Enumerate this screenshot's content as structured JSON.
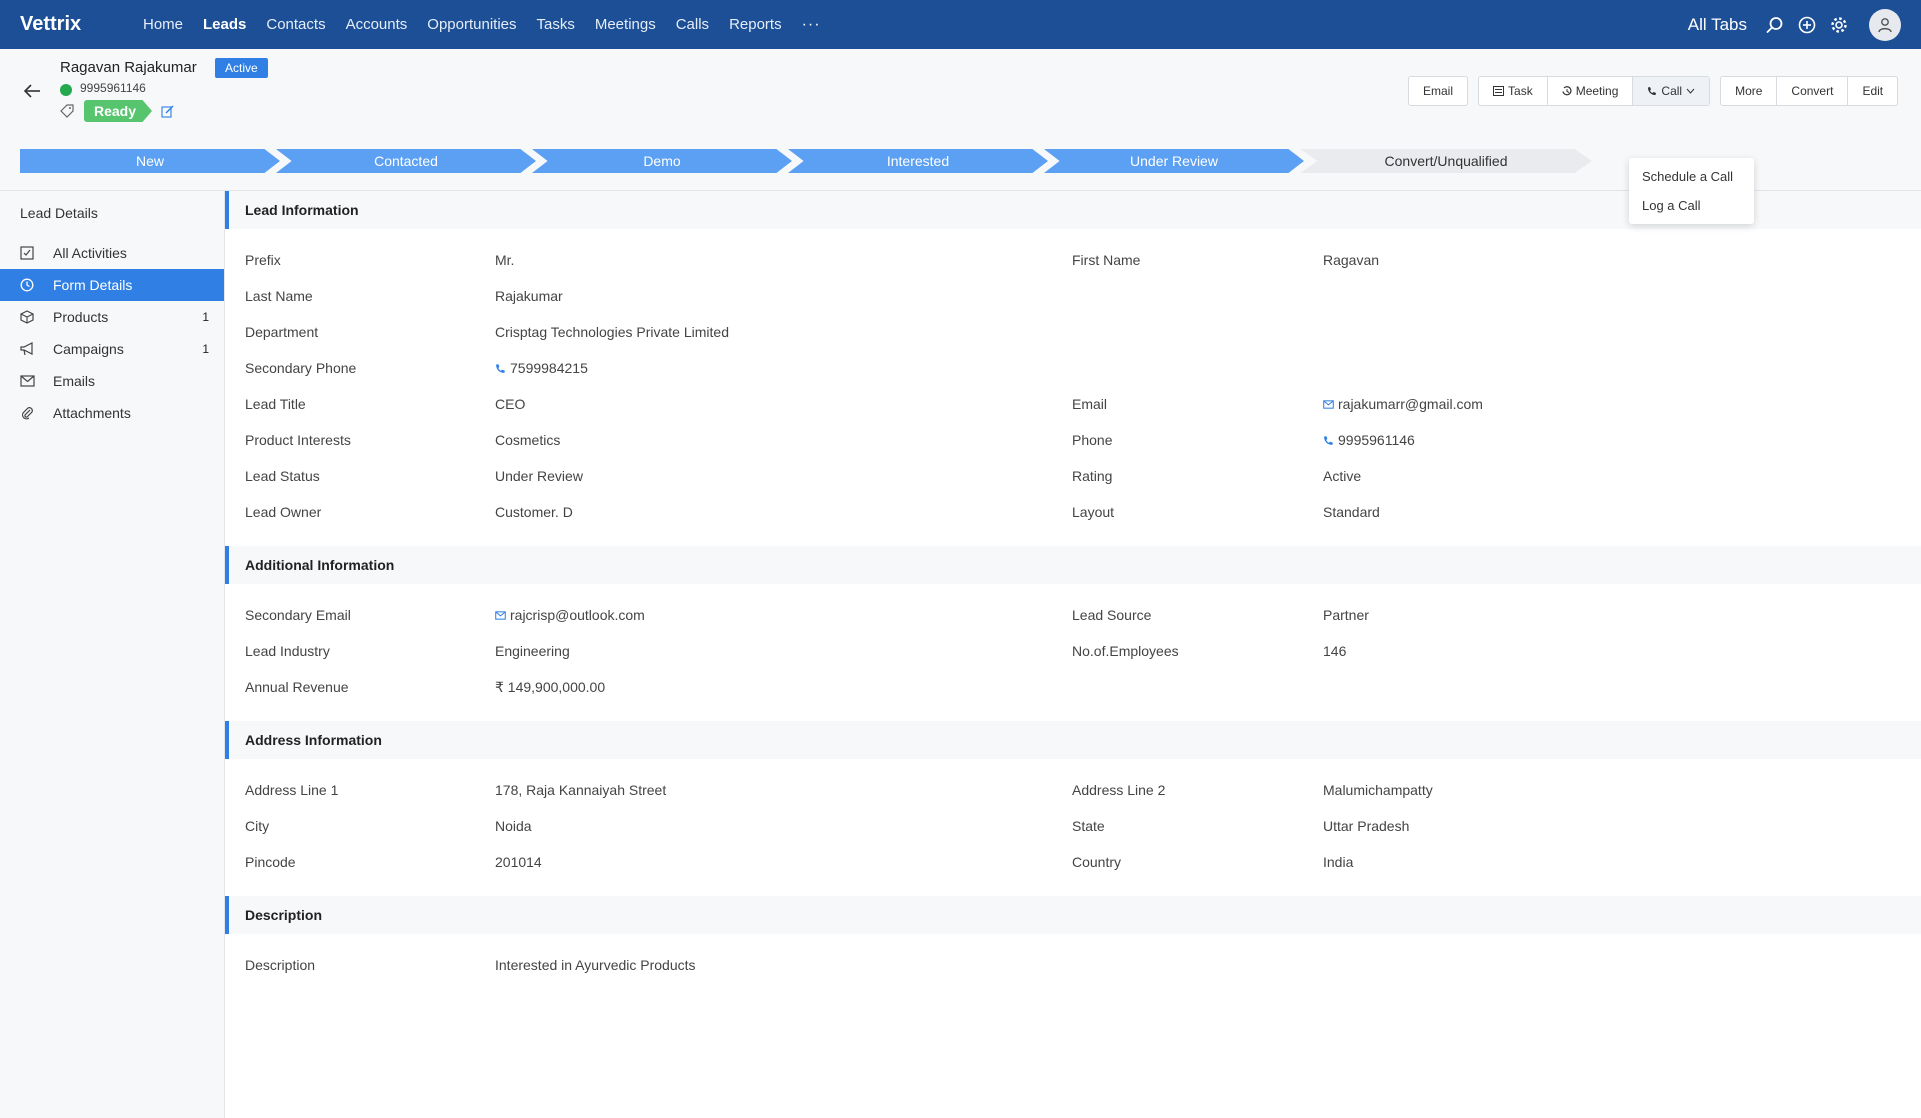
{
  "nav": {
    "brand": "Vettrix",
    "items": [
      "Home",
      "Leads",
      "Contacts",
      "Accounts",
      "Opportunities",
      "Tasks",
      "Meetings",
      "Calls",
      "Reports"
    ],
    "more": "···",
    "all_tabs": "All Tabs"
  },
  "header": {
    "name": "Ragavan Rajakumar",
    "status_badge": "Active",
    "phone": "9995961146",
    "stage_pill": "Ready"
  },
  "actions": {
    "email": "Email",
    "task": "Task",
    "meeting": "Meeting",
    "call": "Call",
    "more": "More",
    "convert": "Convert",
    "edit": "Edit"
  },
  "call_dropdown": [
    "Schedule a Call",
    "Log a Call"
  ],
  "pipeline": [
    "New",
    "Contacted",
    "Demo",
    "Interested",
    "Under Review",
    "Convert/Unqualified"
  ],
  "sidebar": {
    "title": "Lead Details",
    "items": [
      {
        "label": "All Activities",
        "count": ""
      },
      {
        "label": "Form Details",
        "count": ""
      },
      {
        "label": "Products",
        "count": "1"
      },
      {
        "label": "Campaigns",
        "count": "1"
      },
      {
        "label": "Emails",
        "count": ""
      },
      {
        "label": "Attachments",
        "count": ""
      }
    ]
  },
  "sections": {
    "lead_info": {
      "title": "Lead Information",
      "rows": [
        {
          "l1": "Prefix",
          "v1": "Mr.",
          "l2": "First Name",
          "v2": "Ragavan"
        },
        {
          "l1": "Last Name",
          "v1": "Rajakumar",
          "l2": "",
          "v2": ""
        },
        {
          "l1": "Department",
          "v1": "Crisptag Technologies Private Limited",
          "l2": "",
          "v2": ""
        },
        {
          "l1": "Secondary Phone",
          "v1": "7599984215",
          "l2": "",
          "v2": ""
        },
        {
          "l1": "Lead Title",
          "v1": "CEO",
          "l2": "Email",
          "v2": "rajakumarr@gmail.com"
        },
        {
          "l1": "Product Interests",
          "v1": "Cosmetics",
          "l2": "Phone",
          "v2": "9995961146"
        },
        {
          "l1": "Lead Status",
          "v1": "Under Review",
          "l2": "Rating",
          "v2": "Active"
        },
        {
          "l1": "Lead Owner",
          "v1": "Customer. D",
          "l2": "Layout",
          "v2": "Standard"
        }
      ]
    },
    "additional_info": {
      "title": "Additional Information",
      "rows": [
        {
          "l1": "Secondary Email",
          "v1": "rajcrisp@outlook.com",
          "l2": "Lead Source",
          "v2": "Partner"
        },
        {
          "l1": "Lead Industry",
          "v1": "Engineering",
          "l2": "No.of.Employees",
          "v2": "146"
        },
        {
          "l1": "Annual Revenue",
          "v1": "₹ 149,900,000.00",
          "l2": "",
          "v2": ""
        }
      ]
    },
    "address_info": {
      "title": "Address Information",
      "rows": [
        {
          "l1": "Address Line 1",
          "v1": "178, Raja Kannaiyah Street",
          "l2": "Address Line 2",
          "v2": "Malumichampatty"
        },
        {
          "l1": "City",
          "v1": "Noida",
          "l2": "State",
          "v2": "Uttar Pradesh"
        },
        {
          "l1": "Pincode",
          "v1": "201014",
          "l2": "Country",
          "v2": "India"
        }
      ]
    },
    "description": {
      "title": "Description",
      "rows": [
        {
          "l1": "Description",
          "v1": "Interested in Ayurvedic Products",
          "l2": "",
          "v2": ""
        }
      ]
    }
  },
  "colors": {
    "nav_bg": "#1c4f96",
    "accent": "#2f7fe4",
    "stage_done": "#5ba0f2",
    "ready": "#57c46e"
  }
}
